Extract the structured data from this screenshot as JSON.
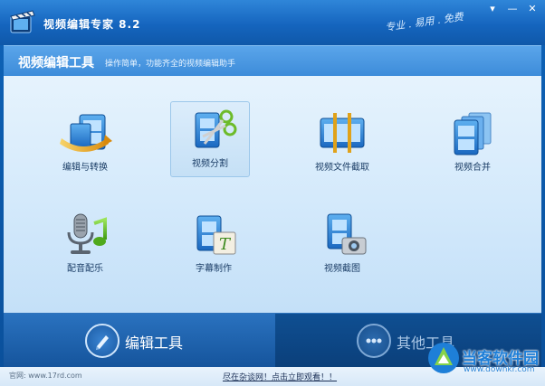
{
  "app": {
    "title": "视频编辑专家 8.2",
    "slogan": "专业 . 易用 . 免费"
  },
  "window_controls": {
    "pin": "▾",
    "minimize": "—",
    "close": "✕"
  },
  "section": {
    "title": "视频编辑工具",
    "subtitle": "操作简单，功能齐全的视频编辑助手"
  },
  "tools": [
    {
      "label": "编辑与转换",
      "icon": "film-convert-icon",
      "selected": false
    },
    {
      "label": "视频分割",
      "icon": "film-scissors-icon",
      "selected": true
    },
    {
      "label": "视频文件截取",
      "icon": "film-cut-icon",
      "selected": false
    },
    {
      "label": "视频合并",
      "icon": "film-merge-icon",
      "selected": false
    },
    {
      "label": "配音配乐",
      "icon": "microphone-music-icon",
      "selected": false
    },
    {
      "label": "字幕制作",
      "icon": "film-subtitle-icon",
      "selected": false
    },
    {
      "label": "视频截图",
      "icon": "film-camera-icon",
      "selected": false
    }
  ],
  "bottom_tabs": [
    {
      "label": "编辑工具",
      "icon": "pen-icon",
      "active": true
    },
    {
      "label": "其他工具",
      "icon": "more-dots-icon",
      "active": false
    }
  ],
  "footer": {
    "website": "官网: www.17rd.com",
    "promo": "尽在杂谈网！点击立即观看！！"
  },
  "watermark": {
    "text": "当客软件园",
    "url": "www.downkr.com"
  },
  "colors": {
    "accent": "#1565be",
    "content_bg": "#d3e9fb",
    "tab_active": "#2a72bf",
    "text_dark": "#1b3d66"
  }
}
